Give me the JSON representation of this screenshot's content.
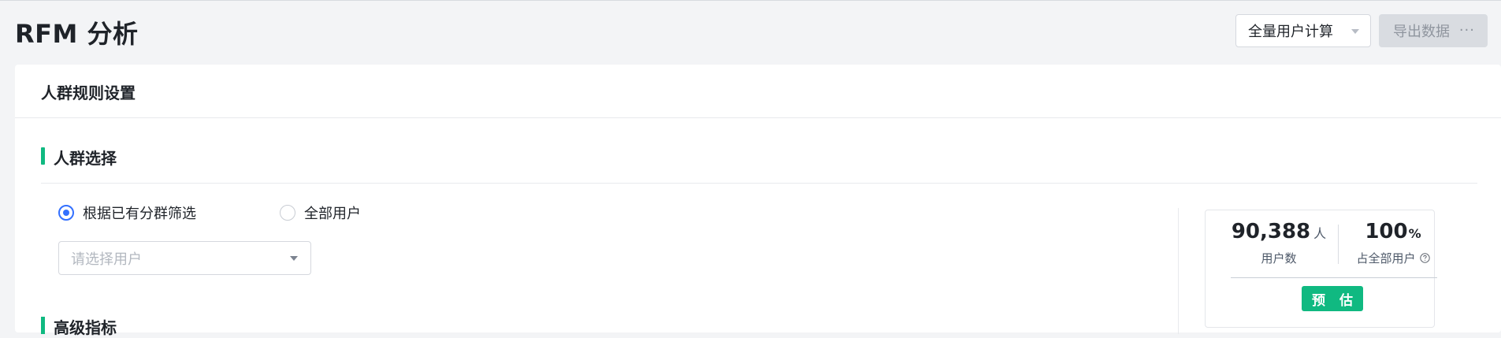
{
  "header": {
    "title": "RFM 分析",
    "scope_select": {
      "value": "全量用户计算"
    },
    "export_button": {
      "label": "导出数据",
      "more_icon": "···"
    }
  },
  "card": {
    "title": "人群规则设置",
    "section": {
      "title": "人群选择",
      "radio_options": [
        {
          "label": "根据已有分群筛选",
          "checked": true
        },
        {
          "label": "全部用户",
          "checked": false
        }
      ],
      "group_select": {
        "placeholder": "请选择用户"
      }
    },
    "next_section": {
      "title": "高级指标"
    },
    "estimate": {
      "users": {
        "value": "90,388",
        "unit": "人",
        "label": "用户数"
      },
      "ratio": {
        "value": "100",
        "unit": "%",
        "label": "占全部用户"
      },
      "button_label": "预 估"
    }
  },
  "icons": {
    "help": "question-circle-icon",
    "caret": "caret-down-icon",
    "more": "more-icon"
  },
  "colors": {
    "accent_green": "#10b981",
    "radio_blue": "#3370ff",
    "background": "#f3f4f6"
  }
}
